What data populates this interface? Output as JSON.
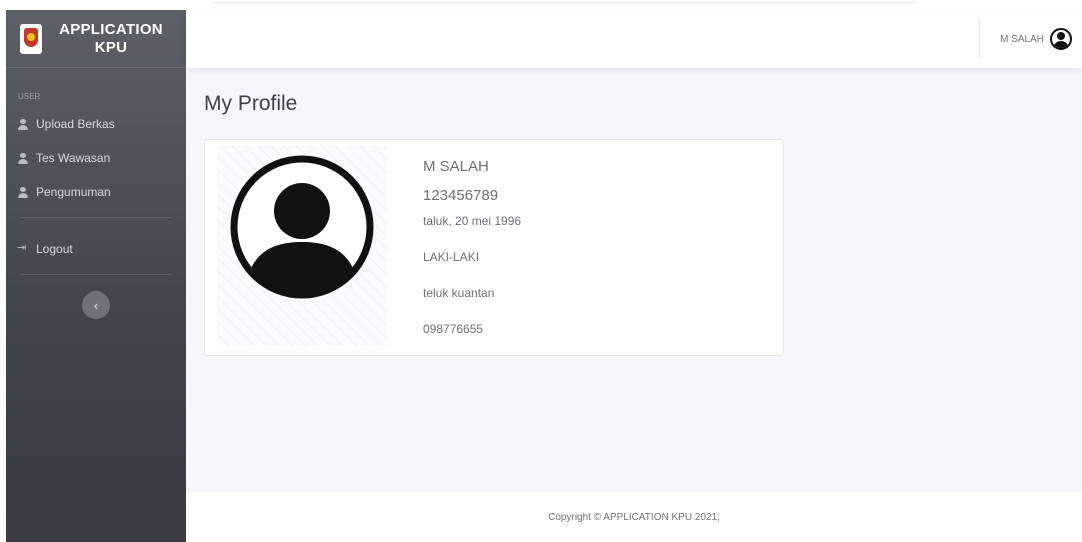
{
  "app": {
    "title_line1": "APPLICATION",
    "title_line2": "KPU",
    "logo": "kpu-emblem"
  },
  "sidebar": {
    "section_label": "USER",
    "items": [
      {
        "label": "Upload Berkas",
        "icon": "user-icon"
      },
      {
        "label": "Tes Wawasan",
        "icon": "user-icon"
      },
      {
        "label": "Pengumuman",
        "icon": "user-icon"
      }
    ],
    "logout": {
      "label": "Logout",
      "icon": "logout-icon"
    },
    "collapse_glyph": "‹"
  },
  "header": {
    "user_name": "M SALAH",
    "avatar_icon": "user-circle-icon"
  },
  "main": {
    "page_title": "My Profile",
    "profile": {
      "name": "M SALAH",
      "id_number": "123456789",
      "birth": "taluk, 20 mei 1996",
      "gender": "LAKI-LAKI",
      "address": "teluk kuantan",
      "phone": "098776655",
      "photo_icon": "user-avatar-icon"
    }
  },
  "footer": {
    "copyright": "Copyright © APPLICATION KPU 2021;"
  },
  "colors": {
    "sidebar": "#4a4c53",
    "page_bg": "#f4f6fa",
    "text": "#6b6f78"
  }
}
